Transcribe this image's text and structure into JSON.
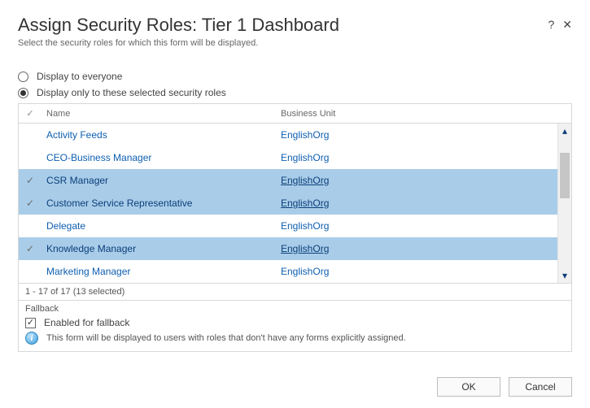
{
  "header": {
    "title": "Assign Security Roles: Tier 1 Dashboard",
    "subtitle": "Select the security roles for which this form will be displayed.",
    "help": "?",
    "close": "✕"
  },
  "radios": {
    "everyone": "Display to everyone",
    "selected": "Display only to these selected security roles"
  },
  "columns": {
    "name": "Name",
    "bu": "Business Unit"
  },
  "rows": [
    {
      "name": "Activity Feeds",
      "bu": "EnglishOrg",
      "selected": false
    },
    {
      "name": "CEO-Business Manager",
      "bu": "EnglishOrg",
      "selected": false
    },
    {
      "name": "CSR Manager",
      "bu": "EnglishOrg",
      "selected": true
    },
    {
      "name": "Customer Service Representative",
      "bu": "EnglishOrg",
      "selected": true
    },
    {
      "name": "Delegate",
      "bu": "EnglishOrg",
      "selected": false
    },
    {
      "name": "Knowledge Manager",
      "bu": "EnglishOrg",
      "selected": true
    },
    {
      "name": "Marketing Manager",
      "bu": "EnglishOrg",
      "selected": false
    }
  ],
  "pager": "1 - 17 of 17 (13 selected)",
  "fallback": {
    "section": "Fallback",
    "checkbox_label": "Enabled for fallback",
    "checked": true,
    "info": "This form will be displayed to users with roles that don't have any forms explicitly assigned."
  },
  "buttons": {
    "ok": "OK",
    "cancel": "Cancel"
  }
}
